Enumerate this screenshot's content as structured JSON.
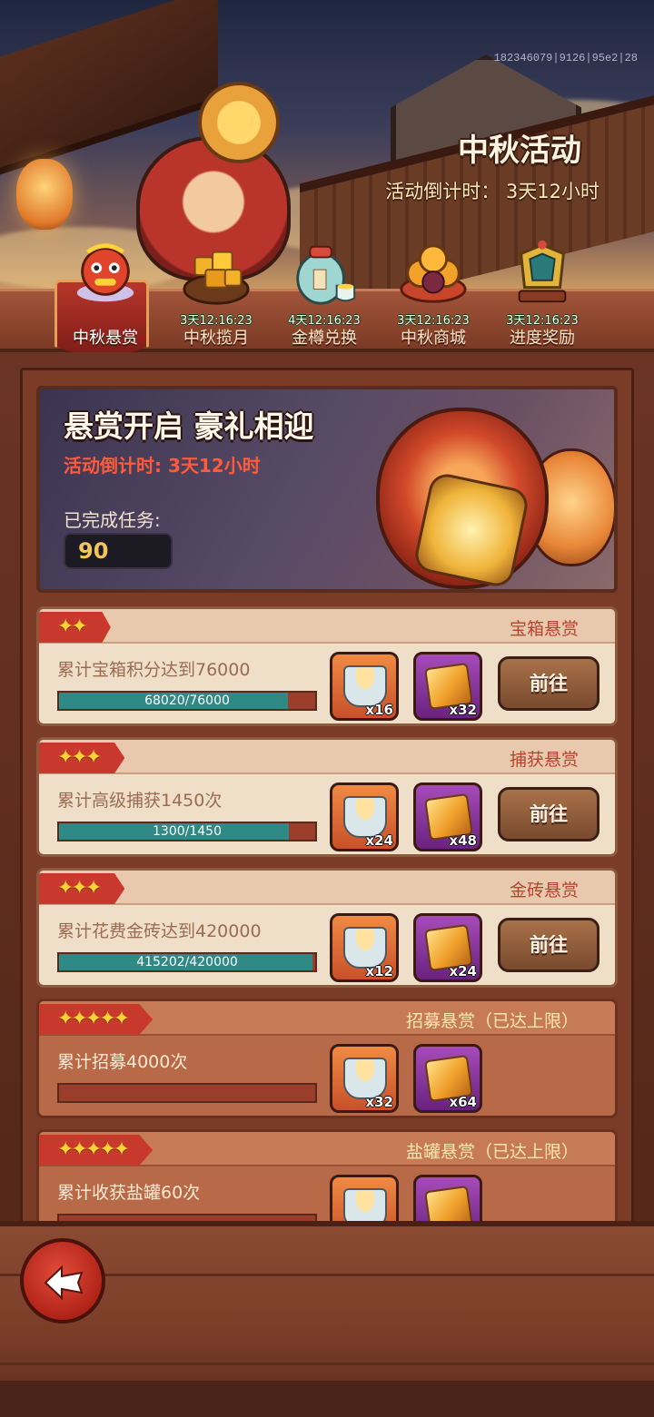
{
  "header": {
    "session_id": "182346079|9126|95e2|28",
    "title": "中秋活动",
    "countdown": "活动倒计时：  3天12小时"
  },
  "tabs": [
    {
      "label": "中秋悬赏",
      "timer": "",
      "active": true,
      "icon": "lion-dance-icon"
    },
    {
      "label": "中秋揽月",
      "timer": "3天12:16:23",
      "active": false,
      "icon": "gold-cubes-basket-icon"
    },
    {
      "label": "金樽兑换",
      "timer": "4天12:16:23",
      "active": false,
      "icon": "wine-jar-icon"
    },
    {
      "label": "中秋商城",
      "timer": "3天12:16:23",
      "active": false,
      "icon": "mooncake-plate-icon"
    },
    {
      "label": "进度奖励",
      "timer": "3天12:16:23",
      "active": false,
      "icon": "trophy-shrine-icon"
    }
  ],
  "hero": {
    "title": "悬赏开启 豪礼相迎",
    "countdown": "活动倒计时: 3天12小时",
    "completed_label": "已完成任务:",
    "completed_value": "90"
  },
  "bounties": [
    {
      "stars": "✦✦",
      "kind": "宝箱悬赏",
      "desc": "累计宝箱积分达到76000",
      "progress_text": "68020/76000",
      "progress": 0.895,
      "cup_qty": "x16",
      "cube_qty": "x32",
      "button": "前往",
      "maxed": false
    },
    {
      "stars": "✦✦✦",
      "kind": "捕获悬赏",
      "desc": "累计高级捕获1450次",
      "progress_text": "1300/1450",
      "progress": 0.897,
      "cup_qty": "x24",
      "cube_qty": "x48",
      "button": "前往",
      "maxed": false
    },
    {
      "stars": "✦✦✦",
      "kind": "金砖悬赏",
      "desc": "累计花费金砖达到420000",
      "progress_text": "415202/420000",
      "progress": 0.989,
      "cup_qty": "x12",
      "cube_qty": "x24",
      "button": "前往",
      "maxed": false
    },
    {
      "stars": "✦✦✦✦✦",
      "kind": "招募悬赏（已达上限）",
      "desc": "累计招募4000次",
      "progress_text": "",
      "progress": 0,
      "cup_qty": "x32",
      "cube_qty": "x64",
      "button": "",
      "maxed": true
    },
    {
      "stars": "✦✦✦✦✦",
      "kind": "盐罐悬赏（已达上限）",
      "desc": "累计收获盐罐60次",
      "progress_text": "",
      "progress": 0,
      "cup_qty": "",
      "cube_qty": "",
      "button": "",
      "maxed": true
    }
  ],
  "colors": {
    "accent_red": "#c9382c",
    "progress_teal": "#2f8a86",
    "card_bg": "#f0dfc8"
  }
}
